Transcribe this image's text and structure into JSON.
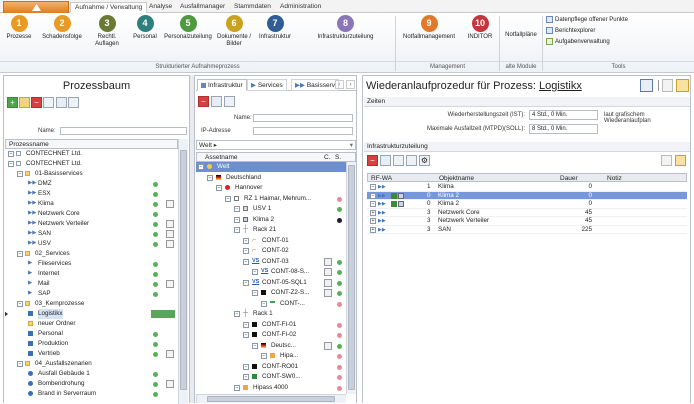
{
  "tabs": [
    "Aufnahme / Verwaltung",
    "Analyse",
    "Ausfallmanager",
    "Stammdaten",
    "Administration"
  ],
  "ribbon": {
    "buttons": [
      {
        "label": "Prozesse",
        "num": "1",
        "color": "#e89a22"
      },
      {
        "label": "Schadensfolge",
        "num": "2",
        "color": "#e89a22"
      },
      {
        "label": "Rechtl. Auflagen",
        "num": "3",
        "color": "#6b7a33"
      },
      {
        "label": "Personal",
        "num": "4",
        "color": "#2f7f7f"
      },
      {
        "label": "Personalzuteilung",
        "num": "5",
        "color": "#4f9a3f"
      },
      {
        "label": "Dokumente / Bilder",
        "num": "6",
        "color": "#c9a21f"
      },
      {
        "label": "Infrastruktur",
        "num": "7",
        "color": "#2e5e95"
      },
      {
        "label": "Infrastrukturzuteilung",
        "num": "8",
        "color": "#8a75b8"
      },
      {
        "label": "Notfallmanagement",
        "num": "9",
        "color": "#e07a2a"
      },
      {
        "label": "INDITOR",
        "num": "10",
        "color": "#c7343b"
      }
    ],
    "notfallplaene": "Notfallpläne",
    "tools": [
      "Datenpflege offener Punkte",
      "Berichtexplorer",
      "Aufgabenverwaltung"
    ],
    "groups": [
      "Strukturierter Aufnahmeprozess",
      "Management",
      "alte Module",
      "Tools"
    ]
  },
  "left": {
    "title": "Prozessbaum",
    "name_label": "Name:",
    "col": "Prozessname",
    "rows": [
      {
        "t": "CONTECHNET Ltd.",
        "l": 0,
        "i": "doc",
        "d": ""
      },
      {
        "t": "CONTECHNET Ltd.",
        "l": 0,
        "i": "doc",
        "d": ""
      },
      {
        "t": "01-Basisservices",
        "l": 1,
        "i": "folder",
        "d": ""
      },
      {
        "t": "DMZ",
        "l": 2,
        "i": "arrow2",
        "d": "g"
      },
      {
        "t": "ESX",
        "l": 2,
        "i": "arrow2",
        "d": "g"
      },
      {
        "t": "Klima",
        "l": 2,
        "i": "arrow2",
        "d": "gb"
      },
      {
        "t": "Netzwerk Core",
        "l": 2,
        "i": "arrow2",
        "d": "g"
      },
      {
        "t": "Netzwerk Verteiler",
        "l": 2,
        "i": "arrow2",
        "d": "gb"
      },
      {
        "t": "SAN",
        "l": 2,
        "i": "arrow2",
        "d": "gb"
      },
      {
        "t": "USV",
        "l": 2,
        "i": "arrow2",
        "d": "gb"
      },
      {
        "t": "02_Services",
        "l": 1,
        "i": "folder",
        "d": ""
      },
      {
        "t": "Fileservices",
        "l": 2,
        "i": "arrow",
        "d": "g"
      },
      {
        "t": "Internet",
        "l": 2,
        "i": "arrow",
        "d": "g"
      },
      {
        "t": "Mail",
        "l": 2,
        "i": "arrow",
        "d": "gb"
      },
      {
        "t": "SAP",
        "l": 2,
        "i": "arrow",
        "d": "g"
      },
      {
        "t": "03_Kernprozesse",
        "l": 1,
        "i": "folder",
        "d": ""
      },
      {
        "t": "Logistikx",
        "l": 2,
        "i": "blue",
        "d": "sel"
      },
      {
        "t": "neuer Ordner",
        "l": 2,
        "i": "yellow",
        "d": ""
      },
      {
        "t": "Personal",
        "l": 2,
        "i": "blue",
        "d": "g"
      },
      {
        "t": "Produktion",
        "l": 2,
        "i": "blue",
        "d": "g"
      },
      {
        "t": "Vertrieb",
        "l": 2,
        "i": "blue",
        "d": "gb"
      },
      {
        "t": "04_Ausfallszenarien",
        "l": 1,
        "i": "folder",
        "d": ""
      },
      {
        "t": "Ausfall Gebäude 1",
        "l": 2,
        "i": "circle",
        "d": "g"
      },
      {
        "t": "Bombendrohung",
        "l": 2,
        "i": "circle",
        "d": "gb"
      },
      {
        "t": "Brand in Serverraum",
        "l": 2,
        "i": "circle",
        "d": "g"
      }
    ]
  },
  "mid": {
    "tabs": [
      "Infrastruktur",
      "Services",
      "Basisserv"
    ],
    "name_label": "Name:",
    "ip_label": "IP-Adresse",
    "breadcrumb": "Welt",
    "col": "Assetname",
    "col_c": "C.",
    "col_s": "S.",
    "rows": [
      {
        "t": "Welt",
        "l": 0,
        "i": "globe",
        "d": "",
        "sel": true
      },
      {
        "t": "Deutschland",
        "l": 1,
        "i": "flag",
        "d": ""
      },
      {
        "t": "Hannover",
        "l": 2,
        "i": "pin",
        "d": ""
      },
      {
        "t": "RZ 1 Haimar, Mehrum...",
        "l": 3,
        "i": "building",
        "d": "p"
      },
      {
        "t": "USV 1",
        "l": 4,
        "i": "usv",
        "d": "g"
      },
      {
        "t": "Klima 2",
        "l": 4,
        "i": "klima",
        "d": "gd"
      },
      {
        "t": "Rack 21",
        "l": 4,
        "i": "rack",
        "d": ""
      },
      {
        "t": "CONT-01",
        "l": 5,
        "i": "cable",
        "d": ""
      },
      {
        "t": "CONT-02",
        "l": 5,
        "i": "cable",
        "d": ""
      },
      {
        "t": "CONT-03",
        "l": 5,
        "i": "vs",
        "d": "bg"
      },
      {
        "t": "CONT-08-S...",
        "l": 6,
        "i": "vs",
        "d": "bg"
      },
      {
        "t": "CONT-05-SQL1",
        "l": 5,
        "i": "vs",
        "d": "bg"
      },
      {
        "t": "CONT-Z2-S...",
        "l": 6,
        "i": "server",
        "d": "bg"
      },
      {
        "t": "CONT-...",
        "l": 7,
        "i": "line",
        "d": "p"
      },
      {
        "t": "Rack 1",
        "l": 4,
        "i": "rack",
        "d": ""
      },
      {
        "t": "CONT-FI-01",
        "l": 5,
        "i": "server",
        "d": "p"
      },
      {
        "t": "CONT-FI-02",
        "l": 5,
        "i": "server",
        "d": "p"
      },
      {
        "t": "Deutsc...",
        "l": 6,
        "i": "flagsm",
        "d": "bg"
      },
      {
        "t": "Hipa...",
        "l": 7,
        "i": "person",
        "d": "p"
      },
      {
        "t": "CONT-RO01",
        "l": 5,
        "i": "router",
        "d": "p"
      },
      {
        "t": "CONT-SW0...",
        "l": 5,
        "i": "switch",
        "d": "p"
      },
      {
        "t": "Hipass 4000",
        "l": 4,
        "i": "person",
        "d": "p"
      }
    ]
  },
  "right": {
    "title_prefix": "Wiederanlaufprozedur für Prozess:",
    "title_name": "Logistikx",
    "zeiten": "Zeiten",
    "ist_label": "Wiederherstellungszeit (IST):",
    "ist_val": "4 Std., 0 Min.",
    "ist_note": "laut grafischem Wiederanlaufplan",
    "soll_label": "Maximale Ausfallzeit (MTPD)(SOLL):",
    "soll_val": "8 Std., 0 Min.",
    "infra": "Infrastrukturzuteilung",
    "cols": [
      "RF-WA",
      "Objektname",
      "Dauer",
      "Notiz"
    ],
    "rows": [
      {
        "rf": "1",
        "obj": "Klima",
        "dauer": "0",
        "sel": false
      },
      {
        "rf": "0",
        "obj": "Klima 2",
        "dauer": "0",
        "sel": true
      },
      {
        "rf": "0",
        "obj": "Klima 2",
        "dauer": "0",
        "sel": false
      },
      {
        "rf": "3",
        "obj": "Netzwerk Core",
        "dauer": "45",
        "sel": false
      },
      {
        "rf": "3",
        "obj": "Netzwerk Verteiler",
        "dauer": "45",
        "sel": false
      },
      {
        "rf": "3",
        "obj": "SAN",
        "dauer": "225",
        "sel": false
      }
    ]
  }
}
